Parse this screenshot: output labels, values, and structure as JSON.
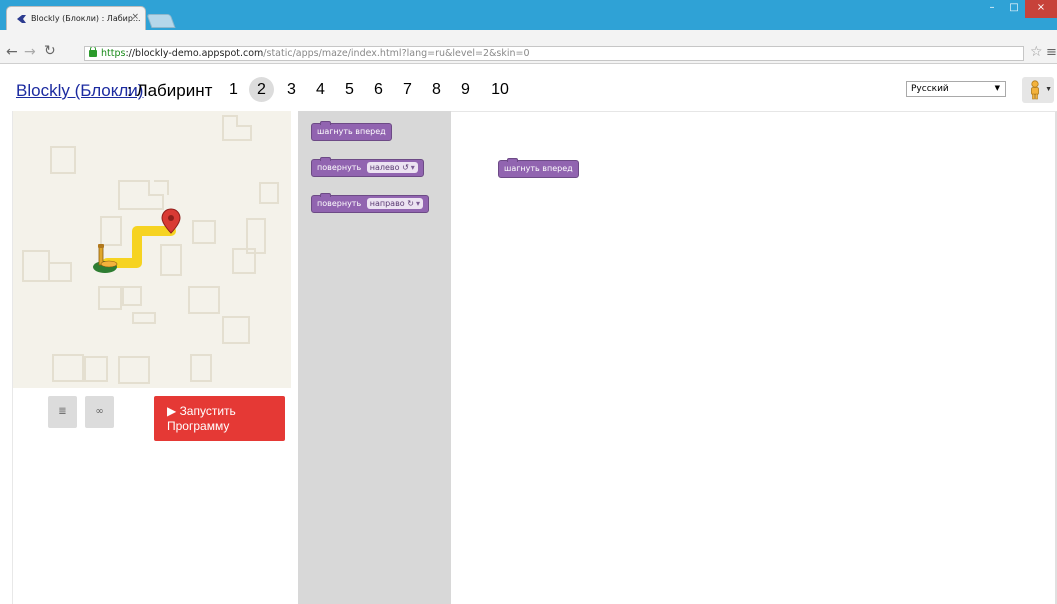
{
  "browser": {
    "tab_title": "Blockly (Блокли) : Лабир...",
    "tab_close": "×",
    "url_https": "https",
    "url_host": "://blockly-demo.appspot.com",
    "url_path": "/static/apps/maze/index.html?lang=ru&level=2&skin=0",
    "back_icon": "back-arrow-icon",
    "forward_icon": "forward-arrow-icon",
    "reload_icon": "reload-icon",
    "star_icon": "star-icon",
    "menu_icon": "menu-icon",
    "window_buttons": [
      "–",
      "□",
      "×"
    ]
  },
  "header": {
    "app_link": "Blockly (Блокли)",
    "separator_title": ": Лабиринт",
    "levels": [
      "1",
      "2",
      "3",
      "4",
      "5",
      "6",
      "7",
      "8",
      "9",
      "10"
    ],
    "current_level": "2",
    "language": "Русский"
  },
  "controls": {
    "code_icon": "code-icon",
    "link_icon": "link-icon",
    "run_button": "▶  Запустить Программу"
  },
  "toolbox": {
    "move_forward": "шагнуть вперед",
    "turn_prefix": "повернуть",
    "turn_left": "налево",
    "turn_right": "направо",
    "turn_left_glyph": "↺",
    "turn_right_glyph": "↻",
    "dropdown_caret": "▾"
  },
  "workspace": {
    "block_move": "шагнуть вперед"
  },
  "colors": {
    "block": "#9164b0",
    "run": "#e53935",
    "path": "#f6d321",
    "titlebar": "#2fa2d6"
  }
}
